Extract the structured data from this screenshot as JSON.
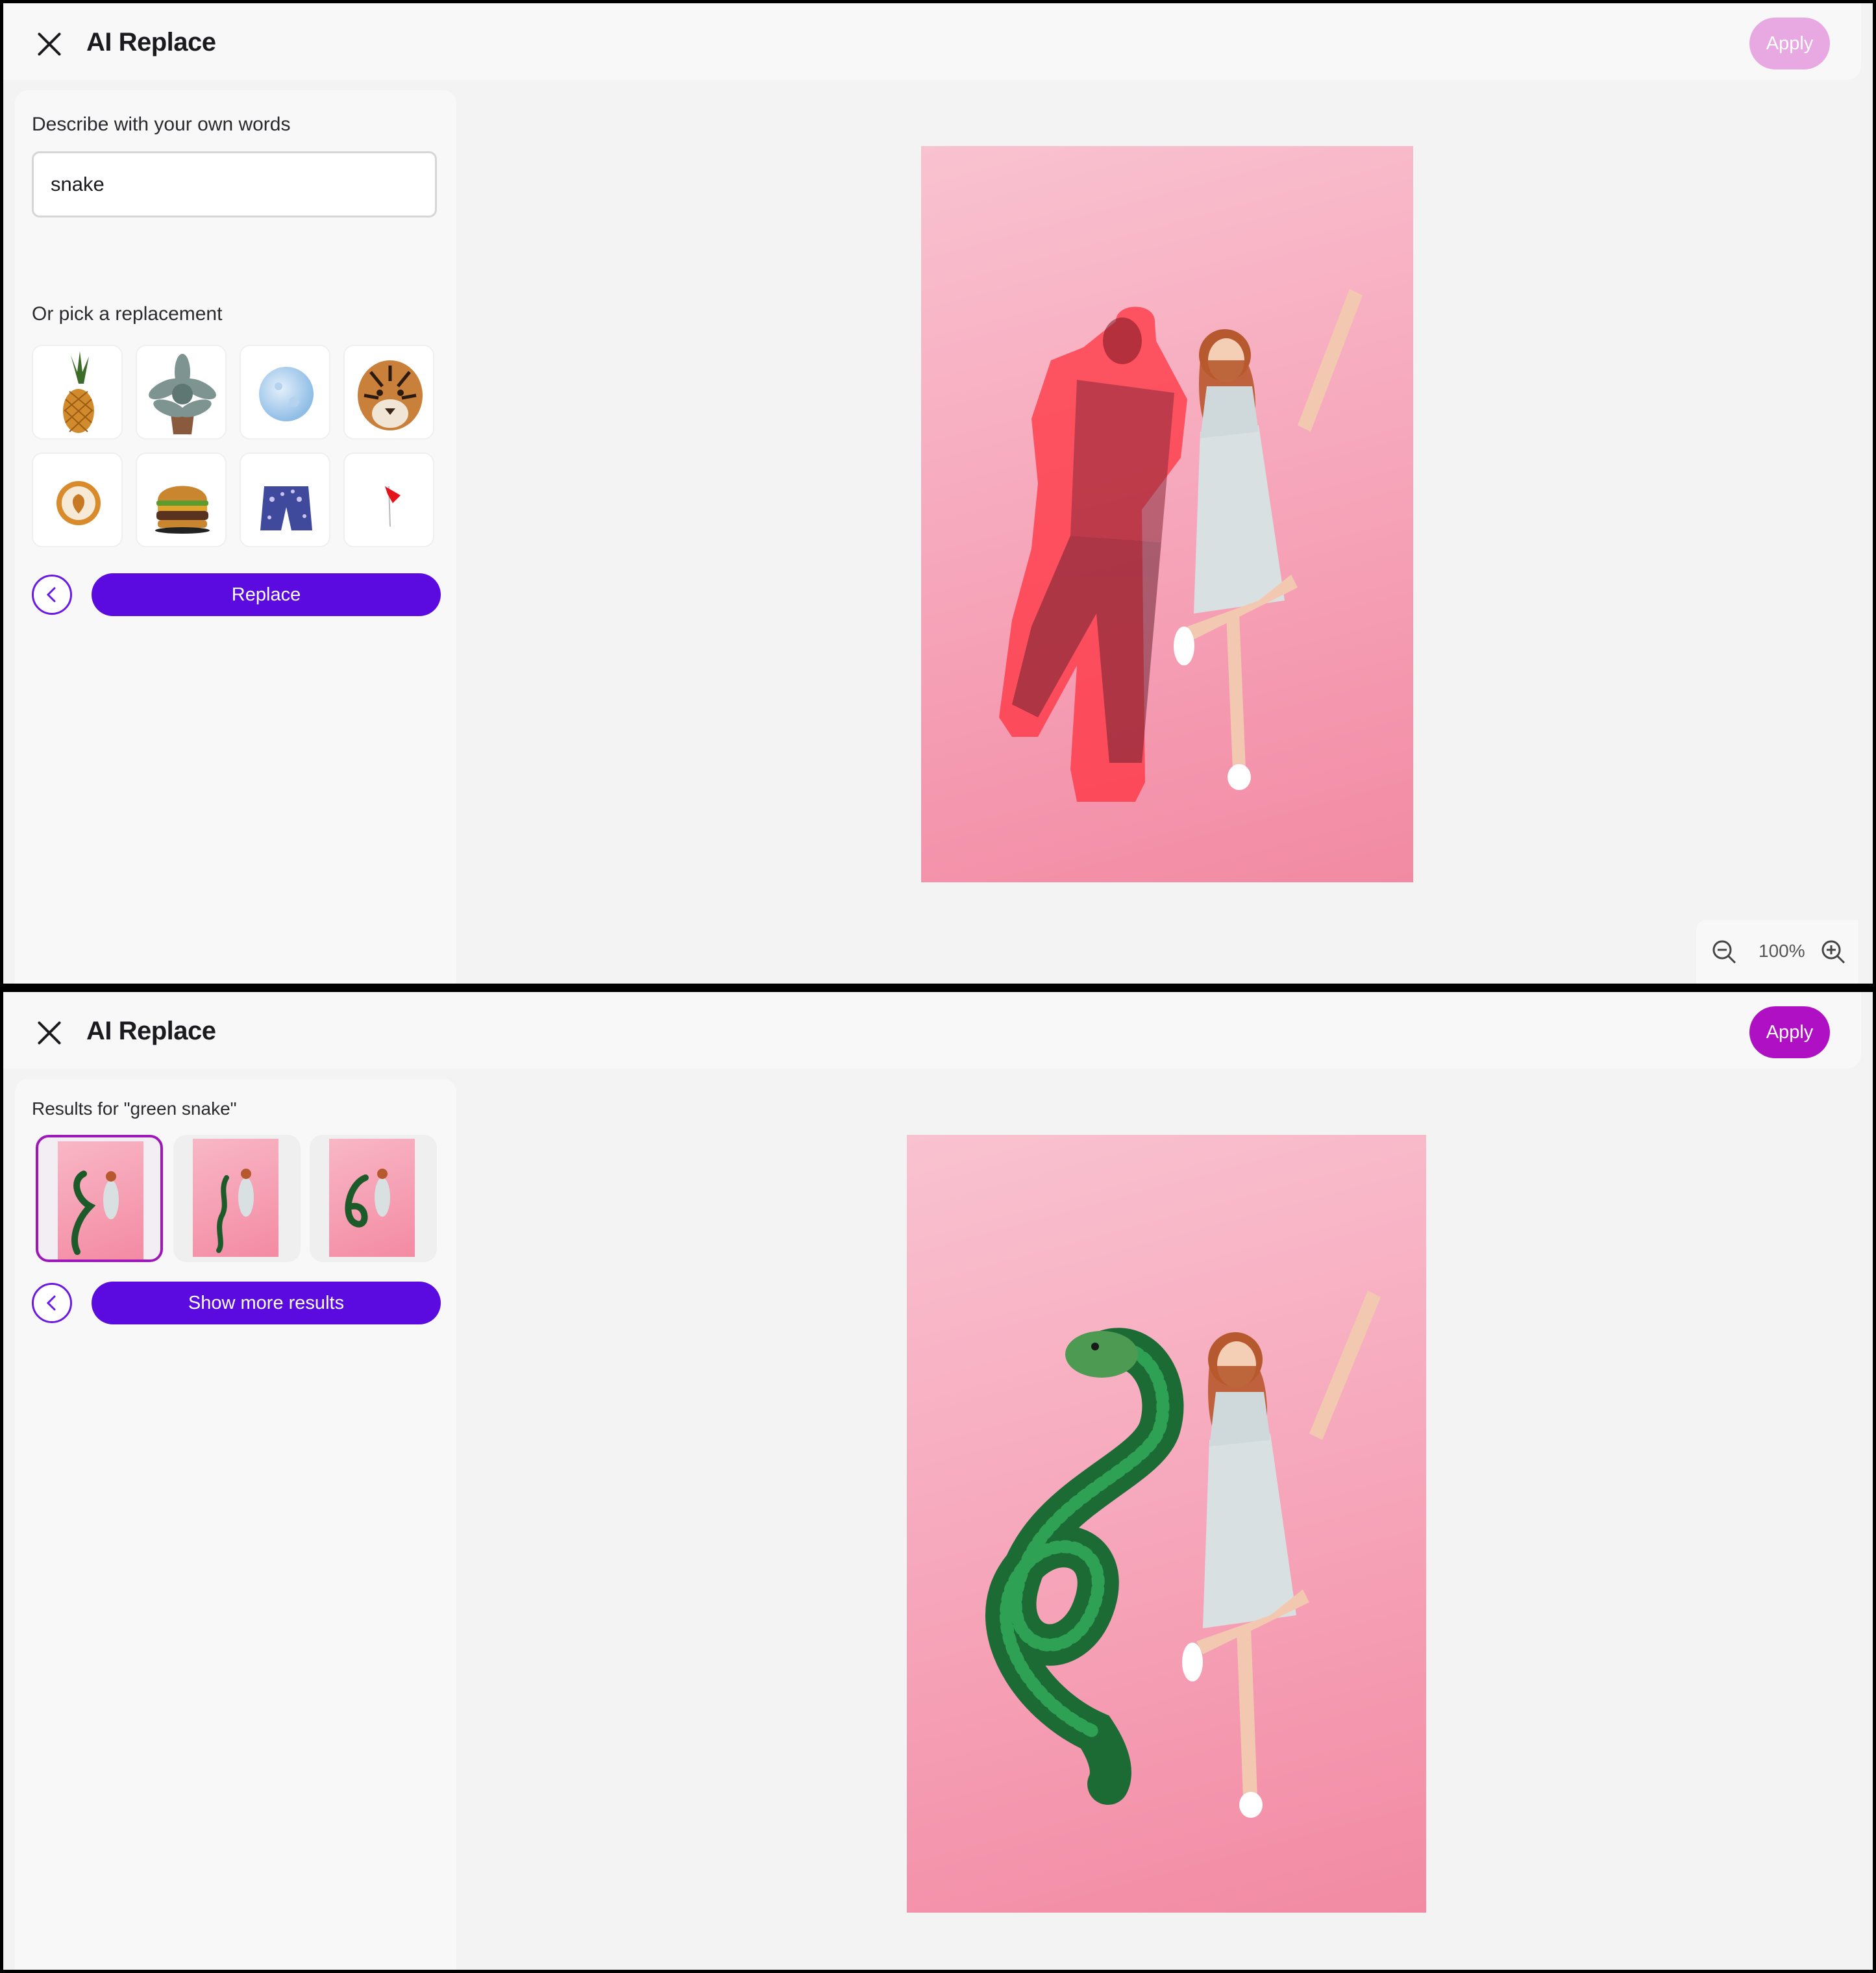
{
  "screen1": {
    "title": "AI Replace",
    "apply_label": "Apply",
    "describe_label": "Describe with your own words",
    "prompt_value": "snake",
    "pick_label": "Or pick a replacement",
    "replacements": [
      {
        "name": "pineapple",
        "icon": "pineapple-icon"
      },
      {
        "name": "succulent",
        "icon": "succulent-icon"
      },
      {
        "name": "moon",
        "icon": "moon-icon"
      },
      {
        "name": "tiger",
        "icon": "tiger-icon"
      },
      {
        "name": "latte",
        "icon": "latte-icon"
      },
      {
        "name": "burger",
        "icon": "burger-icon"
      },
      {
        "name": "shorts",
        "icon": "shorts-icon"
      },
      {
        "name": "flag",
        "icon": "flag-icon"
      }
    ],
    "replace_label": "Replace",
    "zoom_level": "100%"
  },
  "screen2": {
    "title": "AI Replace",
    "apply_label": "Apply",
    "results_label": "Results for \"green snake\"",
    "results_count": 3,
    "selected_index": 0,
    "show_more_label": "Show more results"
  },
  "colors": {
    "accent": "#5b0be0",
    "apply_enabled": "#b010c4",
    "apply_disabled": "#e8a8e2",
    "photo_bg": "#f6a3b8",
    "mask": "#ff2e3a"
  }
}
